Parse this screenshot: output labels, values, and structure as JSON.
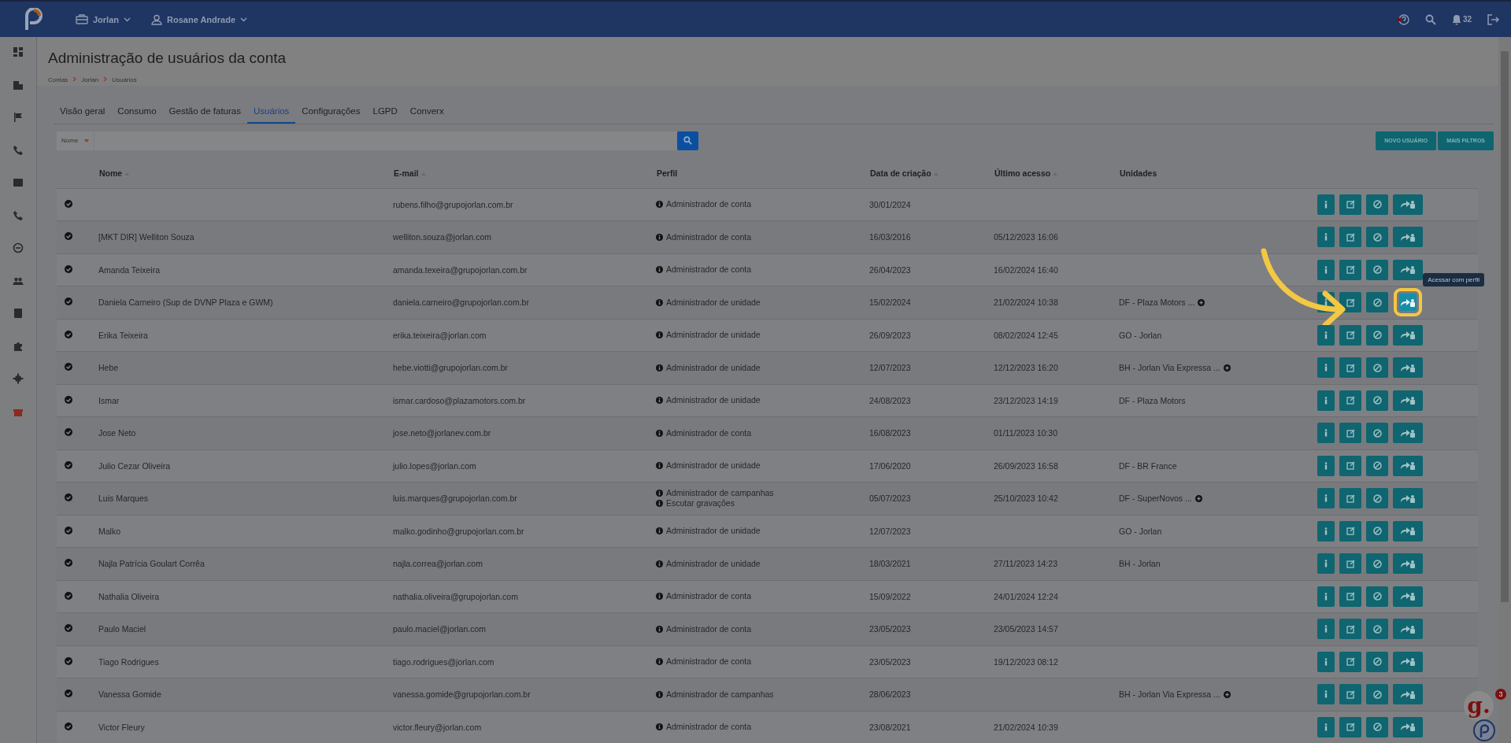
{
  "topbar": {
    "company": "Jorlan",
    "user": "Rosane Andrade",
    "notifications": "32"
  },
  "sidebar": {
    "items": [
      {
        "selected": false
      },
      {
        "selected": false
      },
      {
        "selected": false
      },
      {
        "selected": false
      },
      {
        "selected": false
      },
      {
        "selected": false
      },
      {
        "selected": false
      },
      {
        "selected": false
      },
      {
        "selected": false
      },
      {
        "selected": false
      },
      {
        "selected": false
      },
      {
        "selected": true
      }
    ]
  },
  "page": {
    "title": "Administração de usuários da conta",
    "breadcrumb": [
      "Contas",
      "Jorlan",
      "Usuários"
    ]
  },
  "tabs": [
    {
      "label": "Visão geral",
      "selected": false
    },
    {
      "label": "Consumo",
      "selected": false
    },
    {
      "label": "Gestão de faturas",
      "selected": false
    },
    {
      "label": "Usuários",
      "selected": true
    },
    {
      "label": "Configurações",
      "selected": false
    },
    {
      "label": "LGPD",
      "selected": false
    },
    {
      "label": "Converx",
      "selected": false
    }
  ],
  "search": {
    "filter": "Nome"
  },
  "buttons": [
    "NOVO USUÁRIO",
    "MAIS FILTROS"
  ],
  "table": {
    "columns": [
      {
        "label": "Nome",
        "sortable": true
      },
      {
        "label": "E-mail",
        "sortable": true
      },
      {
        "label": "Perfil",
        "sortable": false
      },
      {
        "label": "Data de criação",
        "sortable": true
      },
      {
        "label": "Último acesso",
        "sortable": true
      },
      {
        "label": "Unidades",
        "sortable": false
      }
    ],
    "rows": [
      {
        "name": "",
        "email": "rubens.filho@grupojorlan.com.br",
        "profiles": [
          "Administrador de conta"
        ],
        "created": "30/01/2024",
        "last_access": "",
        "unit": "",
        "more_units": false,
        "highlighted": false
      },
      {
        "name": "[MKT DIR] Welliton Souza",
        "email": "welliton.souza@jorlan.com",
        "profiles": [
          "Administrador de conta"
        ],
        "created": "16/03/2016",
        "last_access": "05/12/2023 16:06",
        "unit": "",
        "more_units": false,
        "highlighted": false
      },
      {
        "name": "Amanda Teixeira",
        "email": "amanda.texeira@grupojorlan.com.br",
        "profiles": [
          "Administrador de conta"
        ],
        "created": "26/04/2023",
        "last_access": "16/02/2024 16:40",
        "unit": "",
        "more_units": false,
        "highlighted": false
      },
      {
        "name": "Daniela Carneiro (Sup de DVNP Plaza e GWM)",
        "email": "daniela.carneiro@grupojorlan.com.br",
        "profiles": [
          "Administrador de unidade"
        ],
        "created": "15/02/2024",
        "last_access": "21/02/2024 10:38",
        "unit": "DF - Plaza Motors ...",
        "more_units": true,
        "highlighted": true
      },
      {
        "name": "Erika Teixeira",
        "email": "erika.teixeira@jorlan.com",
        "profiles": [
          "Administrador de unidade"
        ],
        "created": "26/09/2023",
        "last_access": "08/02/2024 12:45",
        "unit": "GO - Jorlan",
        "more_units": false,
        "highlighted": false
      },
      {
        "name": "Hebe",
        "email": "hebe.viotti@grupojorlan.com.br",
        "profiles": [
          "Administrador de unidade"
        ],
        "created": "12/07/2023",
        "last_access": "12/12/2023 16:20",
        "unit": "BH - Jorlan Via Expressa ...",
        "more_units": true,
        "highlighted": false
      },
      {
        "name": "Ismar",
        "email": "ismar.cardoso@plazamotors.com.br",
        "profiles": [
          "Administrador de unidade"
        ],
        "created": "24/08/2023",
        "last_access": "23/12/2023 14:19",
        "unit": "DF - Plaza Motors",
        "more_units": false,
        "highlighted": false
      },
      {
        "name": "Jose Neto",
        "email": "jose.neto@jorlanev.com.br",
        "profiles": [
          "Administrador de conta"
        ],
        "created": "16/08/2023",
        "last_access": "01/11/2023 10:30",
        "unit": "",
        "more_units": false,
        "highlighted": false
      },
      {
        "name": "Julio Cezar Oliveira",
        "email": "julio.lopes@jorlan.com",
        "profiles": [
          "Administrador de unidade"
        ],
        "created": "17/06/2020",
        "last_access": "26/09/2023 16:58",
        "unit": "DF - BR France",
        "more_units": false,
        "highlighted": false
      },
      {
        "name": "Luis Marques",
        "email": "luis.marques@grupojorlan.com.br",
        "profiles": [
          "Administrador de campanhas",
          "Escutar gravações"
        ],
        "created": "05/07/2023",
        "last_access": "25/10/2023 10:42",
        "unit": "DF - SuperNovos ...",
        "more_units": true,
        "highlighted": false
      },
      {
        "name": "Malko",
        "email": "malko.godinho@grupojorlan.com.br",
        "profiles": [
          "Administrador de unidade"
        ],
        "created": "12/07/2023",
        "last_access": "",
        "unit": "GO - Jorlan",
        "more_units": false,
        "highlighted": false
      },
      {
        "name": "Najla Patrícia Goulart Corrêa",
        "email": "najla.correa@jorlan.com",
        "profiles": [
          "Administrador de unidade"
        ],
        "created": "18/03/2021",
        "last_access": "27/11/2023 14:23",
        "unit": "BH - Jorlan",
        "more_units": false,
        "highlighted": false
      },
      {
        "name": "Nathalia Oliveira",
        "email": "nathalia.oliveira@grupojorlan.com",
        "profiles": [
          "Administrador de conta"
        ],
        "created": "15/09/2022",
        "last_access": "24/01/2024 12:24",
        "unit": "",
        "more_units": false,
        "highlighted": false
      },
      {
        "name": "Paulo Maciel",
        "email": "paulo.maciel@jorlan.com",
        "profiles": [
          "Administrador de conta"
        ],
        "created": "23/05/2023",
        "last_access": "23/05/2023 14:57",
        "unit": "",
        "more_units": false,
        "highlighted": false
      },
      {
        "name": "Tiago Rodrigues",
        "email": "tiago.rodrigues@jorlan.com",
        "profiles": [
          "Administrador de conta"
        ],
        "created": "23/05/2023",
        "last_access": "19/12/2023 08:12",
        "unit": "",
        "more_units": false,
        "highlighted": false
      },
      {
        "name": "Vanessa Gomide",
        "email": "vanessa.gomide@grupojorlan.com.br",
        "profiles": [
          "Administrador de campanhas"
        ],
        "created": "28/06/2023",
        "last_access": "",
        "unit": "BH - Jorlan Via Expressa ...",
        "more_units": true,
        "highlighted": false
      },
      {
        "name": "Victor Fleury",
        "email": "victor.fleury@jorlan.com",
        "profiles": [
          "Administrador de conta"
        ],
        "created": "23/08/2021",
        "last_access": "21/02/2024 10:39",
        "unit": "",
        "more_units": false,
        "highlighted": false
      }
    ]
  },
  "guide": {
    "tooltip": "Acessar com perfil"
  },
  "chat_widget": {
    "logo": "g.",
    "badge": "3"
  }
}
